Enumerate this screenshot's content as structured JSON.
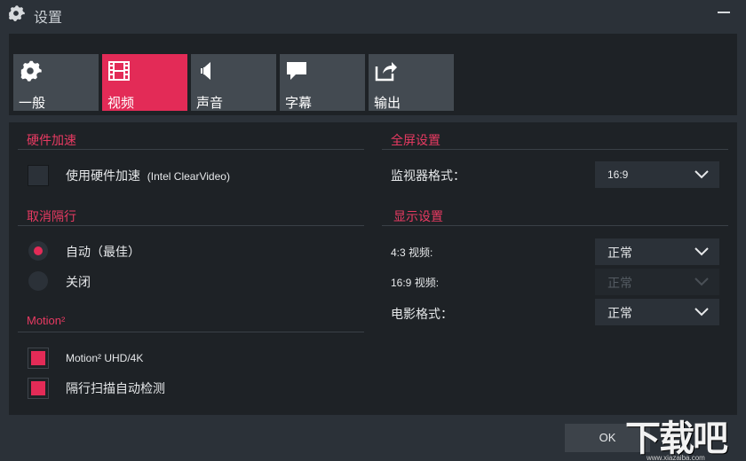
{
  "window": {
    "title": "设置",
    "icon": "gear-icon",
    "close_icon": "minimize-icon"
  },
  "tabs": [
    {
      "label": "一般",
      "icon": "gear-icon",
      "active": false
    },
    {
      "label": "视频",
      "icon": "film-icon",
      "active": true
    },
    {
      "label": "声音",
      "icon": "speaker-icon",
      "active": false
    },
    {
      "label": "字幕",
      "icon": "speech-bubble-icon",
      "active": false
    },
    {
      "label": "输出",
      "icon": "export-icon",
      "active": false
    }
  ],
  "hardware_accel": {
    "title": "硬件加速",
    "use_label": "使用硬件加速",
    "use_detail": "(Intel ClearVideo)",
    "checked": false
  },
  "deinterlace": {
    "title": "取消隔行",
    "options": [
      {
        "label": "自动（最佳）",
        "selected": true
      },
      {
        "label": "关闭",
        "selected": false
      }
    ]
  },
  "motion": {
    "title": "Motion²",
    "options": [
      {
        "label": "Motion² UHD/4K",
        "checked": true
      },
      {
        "label": "隔行扫描自动检测",
        "checked": true
      }
    ]
  },
  "fullscreen": {
    "title": "全屏设置",
    "monitor_format_label": "监视器格式：",
    "monitor_format_value": "16:9"
  },
  "display": {
    "title": "显示设置",
    "rows": [
      {
        "label": "4:3 视频:",
        "value": "正常",
        "enabled": true
      },
      {
        "label": "16:9 视频:",
        "value": "正常",
        "enabled": false
      },
      {
        "label": "电影格式：",
        "value": "正常",
        "enabled": true
      }
    ]
  },
  "footer": {
    "ok_label": "OK"
  },
  "watermark": {
    "main": "下载吧",
    "sub": "www.xiazaiba.com"
  },
  "colors": {
    "accent": "#e32b57",
    "background": "#2b3138",
    "panel": "#1e2226",
    "tab_inactive": "#434a51"
  }
}
